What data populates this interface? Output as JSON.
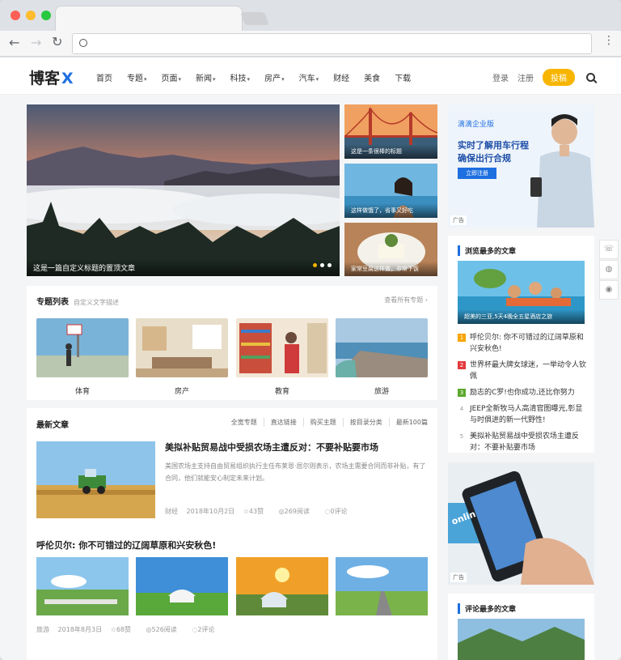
{
  "site": {
    "logo_text": "博客",
    "logo_mark": "X"
  },
  "nav": [
    {
      "label": "首页",
      "caret": false
    },
    {
      "label": "专题",
      "caret": true
    },
    {
      "label": "页面",
      "caret": true
    },
    {
      "label": "新闻",
      "caret": true
    },
    {
      "label": "科技",
      "caret": true
    },
    {
      "label": "房产",
      "caret": true
    },
    {
      "label": "汽车",
      "caret": true
    },
    {
      "label": "财经",
      "caret": false
    },
    {
      "label": "美食",
      "caret": false
    },
    {
      "label": "下载",
      "caret": false
    }
  ],
  "header": {
    "login": "登录",
    "register": "注册",
    "submit": "投稿"
  },
  "hero": {
    "caption": "这是一篇自定义标题的置顶文章"
  },
  "side_slides": [
    {
      "caption": "这是一条很棒的标题"
    },
    {
      "caption": "这样做饿了，省事又好吃"
    },
    {
      "caption": "家常豆腐这样做，非常下饭"
    }
  ],
  "topics": {
    "title": "专题列表",
    "subtitle": "自定义文字描述",
    "more": "查看所有专题 ›",
    "items": [
      {
        "label": "体育"
      },
      {
        "label": "房产"
      },
      {
        "label": "教育"
      },
      {
        "label": "旅游"
      }
    ]
  },
  "latest": {
    "title": "最新文章",
    "tabs": [
      "全宽专题",
      "直达链接",
      "购买主题",
      "按目录分类",
      "最新100篇"
    ],
    "article1": {
      "title": "美拟补贴贸易战中受损农场主遭反对：不要补贴要市场",
      "summary": "美国农场主支持自由贸易组织执行主任布莱恩·居尔则表示，农场主需要合同而非补贴，有了合同，他们就能安心制定未来计划。",
      "category": "财经",
      "date": "2018年10月2日",
      "likes": "43赞",
      "views": "269阅读",
      "comments": "0评论"
    },
    "article2": {
      "title": "呼伦贝尔: 你不可错过的辽阔草原和兴安秋色!",
      "category": "旅游",
      "date": "2018年8月3日",
      "likes": "68赞",
      "views": "526阅读",
      "comments": "2评论"
    }
  },
  "ad1": {
    "brand": "滴滴企业版",
    "headline1": "实时了解用车行程",
    "headline2": "确保出行合规",
    "cta": "立即注册",
    "tag": "广告"
  },
  "most_viewed": {
    "title": "浏览最多的文章",
    "image_caption": "超美的三亚,5天4晚全五星酒店之旅",
    "items": [
      {
        "num": "1",
        "text": "呼伦贝尔: 你不可错过的辽阔草原和兴安秋色!",
        "color": "#f7a400"
      },
      {
        "num": "2",
        "text": "世界杯最大牌女球迷，一举动令人钦佩",
        "color": "#e4393c"
      },
      {
        "num": "3",
        "text": "励志的C罗!也你成功,还比你努力",
        "color": "#5aa82c"
      },
      {
        "num": "4",
        "text": "JEEP全新牧马人高清官图曝光,彰显与时俱进的新一代野性!",
        "color": "#cccccc"
      },
      {
        "num": "5",
        "text": "美拟补贴贸易战中受损农场主遭反对：不要补贴要市场",
        "color": "#cccccc"
      }
    ]
  },
  "ad2": {
    "tag": "广告",
    "brand_fragment": "onlin"
  },
  "most_commented": {
    "title": "评论最多的文章"
  },
  "colors": {
    "accent": "#1e6fe0",
    "button": "#f7b500"
  }
}
